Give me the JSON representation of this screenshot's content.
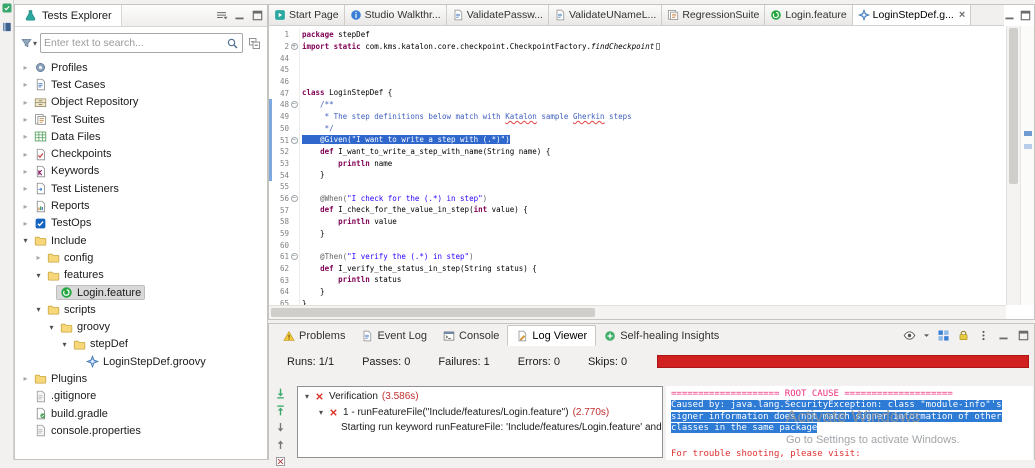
{
  "colors": {
    "selection_blue": "#2f67cc",
    "failure_red": "#d02020",
    "log_selection_blue": "#2e7bd6",
    "root_cause_pink": "#ee2d7e",
    "log_error_red": "#e03030",
    "cucumber_green": "#23a63f"
  },
  "explorer": {
    "title": "Tests Explorer",
    "search": {
      "placeholder": "Enter text to search..."
    },
    "tree": [
      {
        "label": "Profiles",
        "depth": 0,
        "chevron": "right",
        "icon": "gear"
      },
      {
        "label": "Test Cases",
        "depth": 0,
        "chevron": "right",
        "icon": "docblue"
      },
      {
        "label": "Object Repository",
        "depth": 0,
        "chevron": "right",
        "icon": "drawer"
      },
      {
        "label": "Test Suites",
        "depth": 0,
        "chevron": "right",
        "icon": "suite"
      },
      {
        "label": "Data Files",
        "depth": 0,
        "chevron": "right",
        "icon": "table"
      },
      {
        "label": "Checkpoints",
        "depth": 0,
        "chevron": "right",
        "icon": "checkpoint"
      },
      {
        "label": "Keywords",
        "depth": 0,
        "chevron": "right",
        "icon": "keyword"
      },
      {
        "label": "Test Listeners",
        "depth": 0,
        "chevron": "right",
        "icon": "listener"
      },
      {
        "label": "Reports",
        "depth": 0,
        "chevron": "right",
        "icon": "report"
      },
      {
        "label": "TestOps",
        "depth": 0,
        "chevron": "right",
        "icon": "testops"
      },
      {
        "label": "Include",
        "depth": 0,
        "chevron": "down",
        "icon": "folder"
      },
      {
        "label": "config",
        "depth": 1,
        "chevron": "right",
        "icon": "folder"
      },
      {
        "label": "features",
        "depth": 1,
        "chevron": "down",
        "icon": "folder"
      },
      {
        "label": "Login.feature",
        "depth": 2,
        "chevron": "none",
        "icon": "cucumber",
        "selected": true
      },
      {
        "label": "scripts",
        "depth": 1,
        "chevron": "down",
        "icon": "folder"
      },
      {
        "label": "groovy",
        "depth": 2,
        "chevron": "down",
        "icon": "folder"
      },
      {
        "label": "stepDef",
        "depth": 3,
        "chevron": "down",
        "icon": "folder"
      },
      {
        "label": "LoginStepDef.groovy",
        "depth": 4,
        "chevron": "none",
        "icon": "groovy"
      },
      {
        "label": "Plugins",
        "depth": 0,
        "chevron": "right",
        "icon": "folder"
      },
      {
        "label": ".gitignore",
        "depth": 0,
        "chevron": "none",
        "icon": "docgray"
      },
      {
        "label": "build.gradle",
        "depth": 0,
        "chevron": "none",
        "icon": "docgreen"
      },
      {
        "label": "console.properties",
        "depth": 0,
        "chevron": "none",
        "icon": "docgray"
      }
    ]
  },
  "editor": {
    "tabs": [
      {
        "label": "Start Page",
        "icon": "start"
      },
      {
        "label": "Studio Walkthr...",
        "icon": "walkthrough"
      },
      {
        "label": "ValidatePassw...",
        "icon": "docblue"
      },
      {
        "label": "ValidateUNameL...",
        "icon": "docblue"
      },
      {
        "label": "RegressionSuite",
        "icon": "suite"
      },
      {
        "label": "Login.feature",
        "icon": "cucumber"
      },
      {
        "label": "LoginStepDef.g...",
        "icon": "groovy",
        "active": true,
        "close_label": "×"
      }
    ],
    "code": [
      {
        "n": "1",
        "segs": [
          [
            "k",
            "package "
          ],
          [
            "p",
            "stepDef"
          ]
        ]
      },
      {
        "n": "2",
        "fold": "+",
        "segs": [
          [
            "k",
            "import static "
          ],
          [
            "p",
            "com.kms.katalon.core.checkpoint.CheckpointFactory."
          ],
          [
            "pi",
            "findCheckpoint"
          ],
          [
            "box",
            ""
          ]
        ]
      },
      {
        "n": "44",
        "segs": []
      },
      {
        "n": "45",
        "segs": []
      },
      {
        "n": "46",
        "segs": []
      },
      {
        "n": "47",
        "segs": [
          [
            "k",
            "class "
          ],
          [
            "p",
            "LoginStepDef {"
          ]
        ]
      },
      {
        "n": "48",
        "fold": "−",
        "chg": true,
        "segs": [
          [
            "c",
            "    /**"
          ]
        ]
      },
      {
        "n": "49",
        "chg": true,
        "segs": [
          [
            "c",
            "     * The step definitions below match with "
          ],
          [
            "cu",
            "Katalon"
          ],
          [
            "c",
            " sample "
          ],
          [
            "cu",
            "Gherkin"
          ],
          [
            "c",
            " steps"
          ]
        ]
      },
      {
        "n": "50",
        "chg": true,
        "segs": [
          [
            "c",
            "     */"
          ]
        ]
      },
      {
        "n": "51",
        "fold": "−",
        "chg": true,
        "sel": true,
        "segs": [
          [
            "a",
            "    @Given("
          ],
          [
            "s",
            "\"I want to write a step with (.*)\""
          ],
          [
            "a",
            ")"
          ]
        ]
      },
      {
        "n": "52",
        "chg": true,
        "segs": [
          [
            "p",
            "    "
          ],
          [
            "k",
            "def"
          ],
          [
            "p",
            " I_want_to_write_a_step_with_name(String name) {"
          ]
        ]
      },
      {
        "n": "53",
        "chg": true,
        "segs": [
          [
            "p",
            "        "
          ],
          [
            "k",
            "println"
          ],
          [
            "p",
            " name"
          ]
        ]
      },
      {
        "n": "54",
        "chg": true,
        "segs": [
          [
            "p",
            "    }"
          ]
        ]
      },
      {
        "n": "55",
        "segs": []
      },
      {
        "n": "56",
        "fold": "−",
        "segs": [
          [
            "a",
            "    @When("
          ],
          [
            "s",
            "\"I check for the (.*) in step\""
          ],
          [
            "a",
            ")"
          ]
        ]
      },
      {
        "n": "57",
        "segs": [
          [
            "p",
            "    "
          ],
          [
            "k",
            "def"
          ],
          [
            "p",
            " I_check_for_the_value_in_step("
          ],
          [
            "k",
            "int"
          ],
          [
            "p",
            " value) {"
          ]
        ]
      },
      {
        "n": "58",
        "segs": [
          [
            "p",
            "        "
          ],
          [
            "k",
            "println"
          ],
          [
            "p",
            " value"
          ]
        ]
      },
      {
        "n": "59",
        "segs": [
          [
            "p",
            "    }"
          ]
        ]
      },
      {
        "n": "60",
        "segs": []
      },
      {
        "n": "61",
        "fold": "−",
        "segs": [
          [
            "a",
            "    @Then("
          ],
          [
            "s",
            "\"I verify the (.*) in step\""
          ],
          [
            "a",
            ")"
          ]
        ]
      },
      {
        "n": "62",
        "segs": [
          [
            "p",
            "    "
          ],
          [
            "k",
            "def"
          ],
          [
            "p",
            " I_verify_the_status_in_step(String status) {"
          ]
        ]
      },
      {
        "n": "63",
        "segs": [
          [
            "p",
            "        "
          ],
          [
            "k",
            "println"
          ],
          [
            "p",
            " status"
          ]
        ]
      },
      {
        "n": "64",
        "segs": [
          [
            "p",
            "    }"
          ]
        ]
      },
      {
        "n": "65",
        "segs": [
          [
            "p",
            "}"
          ]
        ]
      }
    ]
  },
  "bottom": {
    "tabs": [
      {
        "label": "Problems",
        "icon": "problems"
      },
      {
        "label": "Event Log",
        "icon": "docblue"
      },
      {
        "label": "Console",
        "icon": "console"
      },
      {
        "label": "Log Viewer",
        "icon": "logviewer",
        "active": true
      },
      {
        "label": "Self-healing Insights",
        "icon": "selfheal"
      }
    ],
    "stats": [
      {
        "label": "Runs:",
        "value": "1/1"
      },
      {
        "label": "Passes:",
        "value": "0"
      },
      {
        "label": "Failures:",
        "value": "1"
      },
      {
        "label": "Errors:",
        "value": "0"
      },
      {
        "label": "Skips:",
        "value": "0"
      }
    ],
    "nav_icons": [
      {
        "name": "next-failure-icon",
        "icon": "arrdowng"
      },
      {
        "name": "previous-failure-icon",
        "icon": "arrupg"
      },
      {
        "name": "next-log-icon",
        "icon": "arrdown"
      },
      {
        "name": "previous-log-icon",
        "icon": "arrup"
      },
      {
        "name": "clear-log-icon",
        "icon": "clear"
      }
    ],
    "result_tree": [
      {
        "depth": 0,
        "chevron": "down",
        "icon": "fail",
        "text": "Verification",
        "time": "(3.586s)"
      },
      {
        "depth": 1,
        "chevron": "down",
        "icon": "fail",
        "text": "1 - runFeatureFile(\"Include/features/Login.feature\")",
        "time": "(2.770s)"
      },
      {
        "depth": 2,
        "chevron": "none",
        "icon": "none",
        "text": "Starting run keyword runFeatureFile: 'Include/features/Login.feature' and...",
        "time": ""
      }
    ],
    "log": {
      "lines": [
        {
          "style": "rootcause",
          "text": "==================== ROOT CAUSE ===================="
        },
        {
          "style": "selected",
          "text": "Caused by: java.lang.SecurityException: class \"module-info\"'s"
        },
        {
          "style": "selected",
          "text": "signer information does not match signer information of other"
        },
        {
          "style": "selected",
          "text": "classes in the same package"
        },
        {
          "style": "footer",
          "text": "For trouble shooting, please visit:"
        }
      ]
    }
  },
  "watermark": {
    "line1": "Activate Windows",
    "line2": "Go to Settings to activate Windows."
  }
}
